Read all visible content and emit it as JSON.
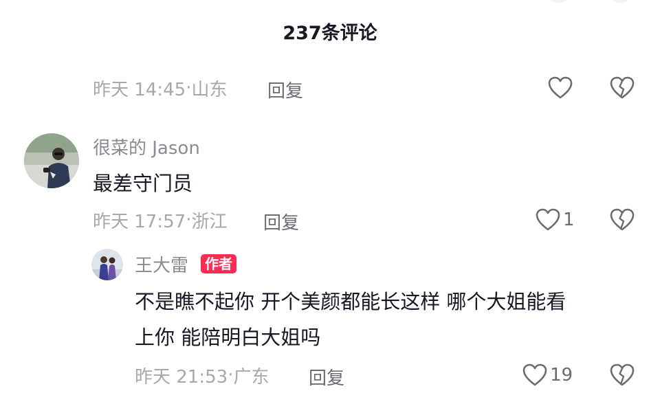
{
  "header": {
    "title": "237条评论"
  },
  "comments": [
    {
      "time": "昨天 14:45",
      "location": "山东",
      "reply_label": "回复",
      "likes": null
    },
    {
      "username": "很菜的 Jason",
      "text": "最差守门员",
      "time": "昨天 17:57",
      "location": "浙江",
      "reply_label": "回复",
      "likes": "1"
    },
    {
      "username": "王大雷",
      "badge": "作者",
      "text_lines": [
        "不是瞧不起你 开个美颜都能长这样 哪个大姐能看",
        "上你 能陪明白大姐吗"
      ],
      "time": "昨天 21:53",
      "location": "广东",
      "reply_label": "回复",
      "likes": "19"
    }
  ],
  "meta_separator": "·",
  "colors": {
    "accent": "#fe2c55",
    "text_primary": "#161823",
    "text_secondary": "#a7a8ab",
    "reply": "#6b6c72",
    "icon": "#6b6c72"
  },
  "icons": {
    "like": "heart-outline-icon",
    "dislike": "broken-heart-icon"
  }
}
